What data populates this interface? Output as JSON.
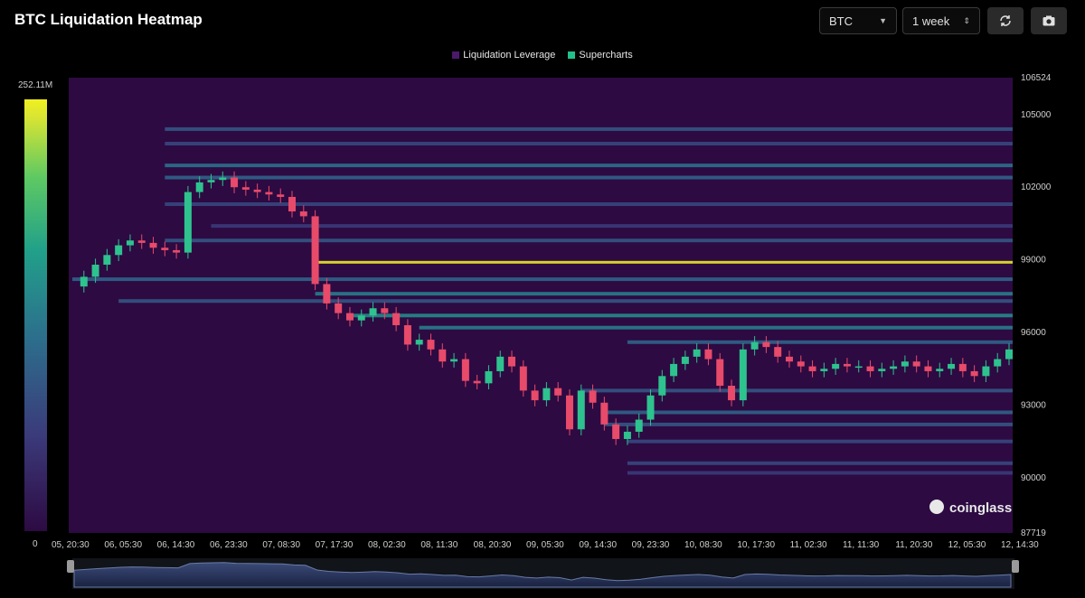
{
  "header": {
    "title": "BTC Liquidation Heatmap",
    "symbol_select": "BTC",
    "range_select": "1 week",
    "refresh_icon": "refresh-icon",
    "camera_icon": "camera-icon"
  },
  "legend": {
    "items": [
      {
        "label": "Liquidation Leverage",
        "color": "#4a1a6a"
      },
      {
        "label": "Supercharts",
        "color": "#22c08a"
      }
    ]
  },
  "colorbar": {
    "max_label": "252.11M",
    "min_label": "0"
  },
  "watermark": "coinglass",
  "chart_data": {
    "type": "heatmap",
    "title": "BTC Liquidation Heatmap",
    "ylim": [
      87719,
      106524
    ],
    "y_ticks": [
      "106524",
      "105000",
      "102000",
      "99000",
      "96000",
      "93000",
      "90000",
      "87719"
    ],
    "y_tick_values": [
      106524,
      105000,
      102000,
      99000,
      96000,
      93000,
      90000,
      87719
    ],
    "x_ticks": [
      "05, 20:30",
      "06, 05:30",
      "06, 14:30",
      "06, 23:30",
      "07, 08:30",
      "07, 17:30",
      "08, 02:30",
      "08, 11:30",
      "08, 20:30",
      "09, 05:30",
      "09, 14:30",
      "09, 23:30",
      "10, 08:30",
      "10, 17:30",
      "11, 02:30",
      "11, 11:30",
      "11, 20:30",
      "12, 05:30",
      "12, 14:30"
    ],
    "colorscale_max": "252.11M",
    "colorscale_min": "0",
    "price_series": {
      "name": "Supercharts",
      "values": [
        97900,
        98300,
        98800,
        99200,
        99600,
        99800,
        99700,
        99500,
        99400,
        99300,
        101800,
        102200,
        102300,
        102400,
        102000,
        101900,
        101800,
        101700,
        101600,
        101000,
        100800,
        98000,
        97200,
        96800,
        96500,
        96700,
        97000,
        96800,
        96300,
        95500,
        95700,
        95300,
        94800,
        94900,
        94000,
        93900,
        94400,
        95000,
        94600,
        93600,
        93200,
        93700,
        93400,
        92000,
        93600,
        93100,
        92200,
        91600,
        91900,
        92400,
        93400,
        94200,
        94700,
        95000,
        95300,
        94900,
        93800,
        93200,
        95300,
        95600,
        95400,
        95000,
        94800,
        94600,
        94400,
        94500,
        94700,
        94600,
        94600,
        94400,
        94500,
        94600,
        94800,
        94600,
        94400,
        94500,
        94700,
        94400,
        94200,
        94600,
        94900,
        95300
      ]
    },
    "liquidation_bands": [
      {
        "price": 98900,
        "intensity": 1.0,
        "from_index": 21
      },
      {
        "price": 97600,
        "intensity": 0.55,
        "from_index": 21
      },
      {
        "price": 96700,
        "intensity": 0.6,
        "from_index": 24
      },
      {
        "price": 96200,
        "intensity": 0.55,
        "from_index": 30
      },
      {
        "price": 102900,
        "intensity": 0.5,
        "from_index": 8
      },
      {
        "price": 102400,
        "intensity": 0.45,
        "from_index": 8
      },
      {
        "price": 104400,
        "intensity": 0.4,
        "from_index": 8
      },
      {
        "price": 103800,
        "intensity": 0.35,
        "from_index": 8
      },
      {
        "price": 101300,
        "intensity": 0.35,
        "from_index": 8
      },
      {
        "price": 100400,
        "intensity": 0.3,
        "from_index": 12
      },
      {
        "price": 99800,
        "intensity": 0.4,
        "from_index": 8
      },
      {
        "price": 98200,
        "intensity": 0.45,
        "from_index": 0
      },
      {
        "price": 97300,
        "intensity": 0.4,
        "from_index": 4
      },
      {
        "price": 93600,
        "intensity": 0.4,
        "from_index": 44
      },
      {
        "price": 92700,
        "intensity": 0.45,
        "from_index": 46
      },
      {
        "price": 92200,
        "intensity": 0.4,
        "from_index": 46
      },
      {
        "price": 91500,
        "intensity": 0.35,
        "from_index": 48
      },
      {
        "price": 90600,
        "intensity": 0.35,
        "from_index": 48
      },
      {
        "price": 90200,
        "intensity": 0.3,
        "from_index": 48
      },
      {
        "price": 95600,
        "intensity": 0.45,
        "from_index": 48
      }
    ]
  }
}
